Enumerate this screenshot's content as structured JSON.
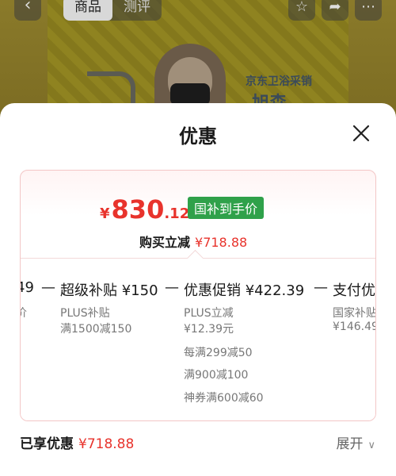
{
  "background": {
    "tabs": [
      {
        "label": "商品"
      },
      {
        "label": "测评"
      }
    ],
    "tagline": "京东卫浴采销",
    "tagline2": "旭森"
  },
  "sheet": {
    "title": "优惠",
    "price": {
      "currency": "¥",
      "integer": "830",
      "decimal": ".12"
    },
    "subsidy_tag": "国补到手价",
    "buy": {
      "label": "购买立减",
      "value": "¥718.88"
    },
    "breakdown": {
      "cut_left_head": "49",
      "cut_left_sub": "价",
      "columns": [
        {
          "head": "超级补贴 ¥150",
          "lines": [
            "PLUS补贴",
            "满1500减150"
          ]
        },
        {
          "head": "优惠促销 ¥422.39",
          "lines": [
            "PLUS立减",
            "¥12.39元",
            "每满299减50",
            "满900减100",
            "神券满600减60"
          ]
        },
        {
          "head": "支付优",
          "lines": [
            "国家补贴",
            "¥146.49"
          ]
        }
      ]
    },
    "enjoyed": {
      "label": "已享优惠",
      "value": "¥718.88"
    },
    "expand_label": "展开"
  },
  "colors": {
    "accent": "#e8332c",
    "subsidy": "#2fa14a"
  }
}
